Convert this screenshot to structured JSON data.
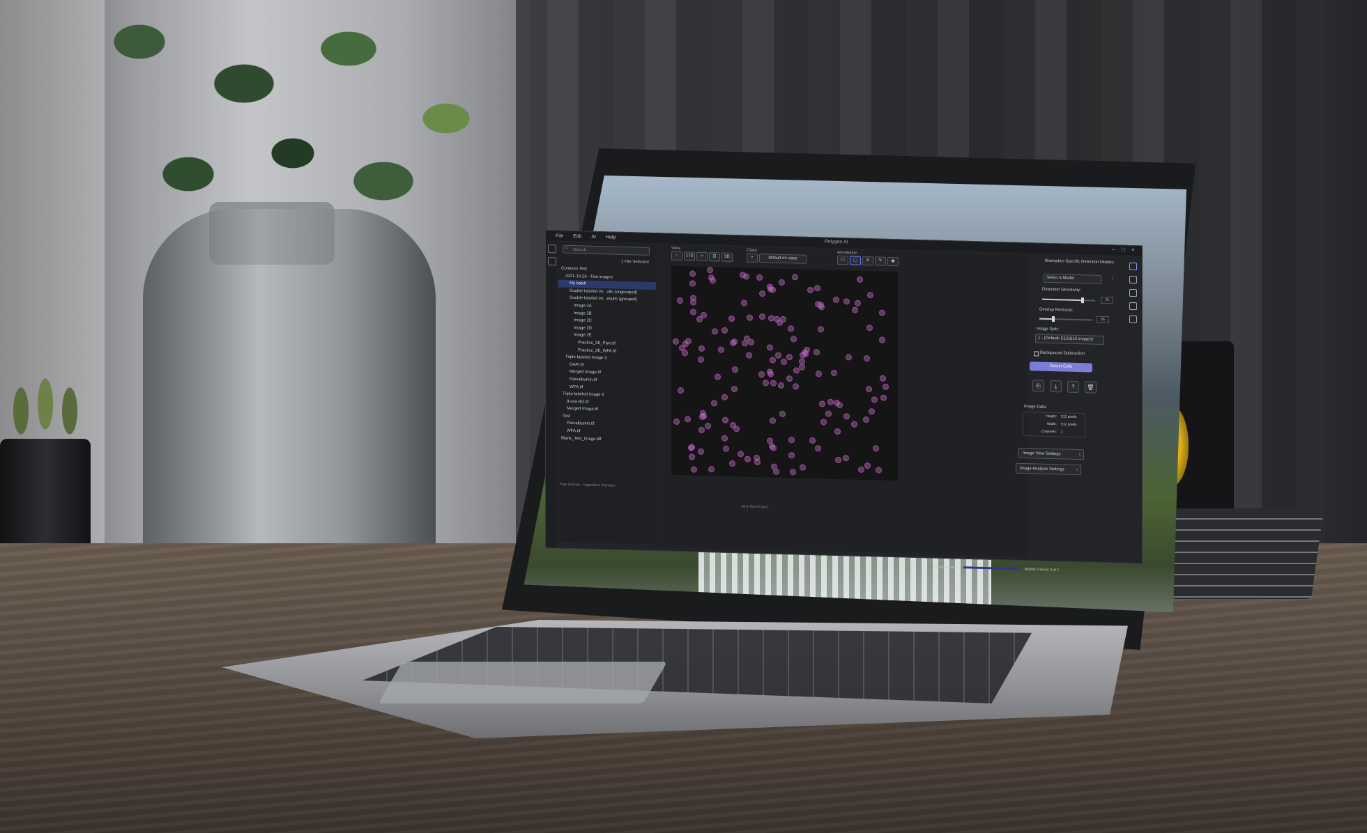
{
  "app": {
    "title": "Polygon AI",
    "menu": [
      "File",
      "Edit",
      "AI",
      "Help"
    ]
  },
  "file_panel": {
    "search_placeholder": "Search",
    "selected_count": "1 File Selected",
    "tree": [
      {
        "label": "Contours Test",
        "selected": false
      },
      {
        "label": "2021-10-26 - Test images",
        "selected": false
      },
      {
        "label": "My batch",
        "selected": true
      },
      {
        "label": "Double-labeled im.. ults (ungrouped)",
        "selected": false
      },
      {
        "label": "Double-labeled im.. esults (grouped)",
        "selected": false
      },
      {
        "label": "Image 2A",
        "selected": false
      },
      {
        "label": "Image 2B",
        "selected": false
      },
      {
        "label": "Image 2C",
        "selected": false
      },
      {
        "label": "Image 2D",
        "selected": false
      },
      {
        "label": "Image 2E",
        "selected": false
      },
      {
        "label": "Practice_2E_Parv.tif",
        "selected": false
      },
      {
        "label": "Practice_2E_WFA.tif",
        "selected": false
      },
      {
        "label": "Triple-labeled Image 3",
        "selected": false
      },
      {
        "label": "DAPI.tif",
        "selected": false
      },
      {
        "label": "Merged Image.tif",
        "selected": false
      },
      {
        "label": "Parvalbumin.tif",
        "selected": false
      },
      {
        "label": "WFA.tif",
        "selected": false
      },
      {
        "label": "Triple-labeled Image 4",
        "selected": false
      },
      {
        "label": "8-oxo-dG.tif",
        "selected": false
      },
      {
        "label": "Merged Image.tif",
        "selected": false
      },
      {
        "label": "Test",
        "selected": false
      },
      {
        "label": "Parvalbumin.tif",
        "selected": false
      },
      {
        "label": "WFA.tif",
        "selected": false
      },
      {
        "label": "Blank_Test_Image.tiff",
        "selected": false
      }
    ]
  },
  "toolbar": {
    "view_label": "View",
    "zoom_value": "173",
    "class_label": "Class",
    "class_value": "default ml class",
    "annotation_label": "Annotation"
  },
  "right_panel": {
    "models_label": "Biomarker-Specific Detection Models:",
    "model_select": "Select a Model",
    "sensitivity_label": "Detection Sensitivity:",
    "sensitivity_value": "75",
    "overlap_label": "Overlap Removal:",
    "overlap_value": "25",
    "split_label": "Image Split:",
    "split_value": "1 - (Default: 512x512 images)",
    "bg_sub_label": "Background Subtraction",
    "detect_button": "Detect Cells",
    "image_data_label": "Image Data:",
    "image_data": [
      {
        "key": "Height:",
        "value": "512 pixels"
      },
      {
        "key": "Width:",
        "value": "512 pixels"
      },
      {
        "key": "Channels:",
        "value": "1"
      }
    ],
    "view_settings": "Image View Settings",
    "analysis_settings": "Image Analysis Settings"
  },
  "status": {
    "license": "Free License - Upgrade to Premium",
    "project": "Jerry Test Project",
    "storage_label": "Storage Usage:",
    "models_trained": "Models Trained: 0 of 2"
  },
  "colors": {
    "accent": "#7b7fd6",
    "cell_outline": "#b23ab8",
    "selection": "#2b3a6a"
  }
}
